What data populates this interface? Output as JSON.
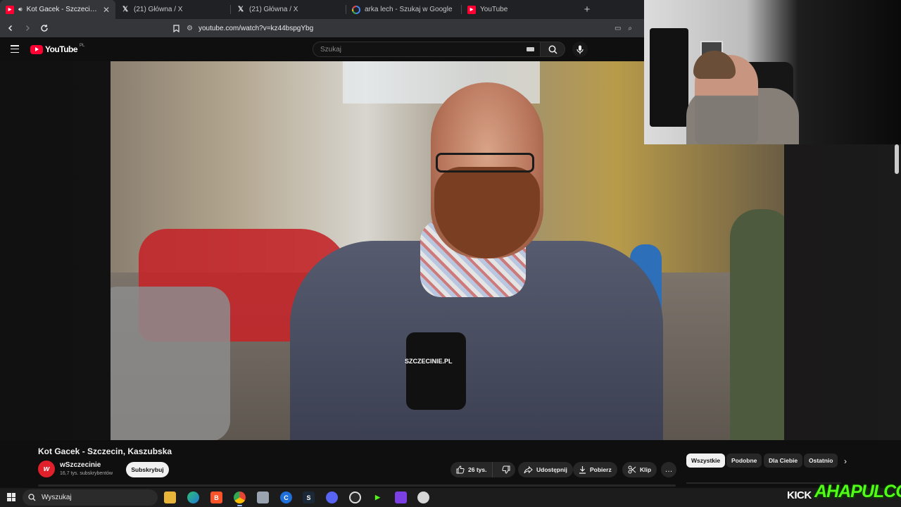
{
  "browser": {
    "tabs": [
      {
        "title": "Kot Gacek - Szczecin, Kaszubs",
        "icon": "youtube-icon",
        "active": true,
        "audio": true
      },
      {
        "title": "(21) Główna / X",
        "icon": "x-icon",
        "active": false
      },
      {
        "title": "(21) Główna / X",
        "icon": "x-icon",
        "active": false
      },
      {
        "title": "arka lech - Szukaj w Google",
        "icon": "google-icon",
        "active": false
      },
      {
        "title": "YouTube",
        "icon": "youtube-icon",
        "active": false
      }
    ],
    "url": "youtube.com/watch?v=kz44bspgYbg"
  },
  "youtube": {
    "logo_text": "YouTube",
    "logo_country": "PL",
    "search_placeholder": "Szukaj"
  },
  "video": {
    "title": "Kot Gacek - Szczecin, Kaszubska",
    "mic_logo": "SZCZECINIE.PL",
    "channel": {
      "name": "wSzczecinie",
      "subscribers": "16,7 tys. subskrybentów",
      "subscribe_label": "Subskrybuj"
    },
    "actions": {
      "likes": "26 tys.",
      "share": "Udostępnij",
      "download": "Pobierz",
      "clip": "Klip",
      "more": "…"
    }
  },
  "chips": [
    "Wszystkie",
    "Podobne",
    "Dla Ciebie",
    "Ostatnio"
  ],
  "taskbar": {
    "search_placeholder": "Wyszukaj"
  },
  "overlay": {
    "kick": "KICK",
    "brand": "AHAPULCO"
  },
  "colors": {
    "yt_red": "#ff0033",
    "kick_green": "#53fc18",
    "bg": "#0f0f0f"
  }
}
